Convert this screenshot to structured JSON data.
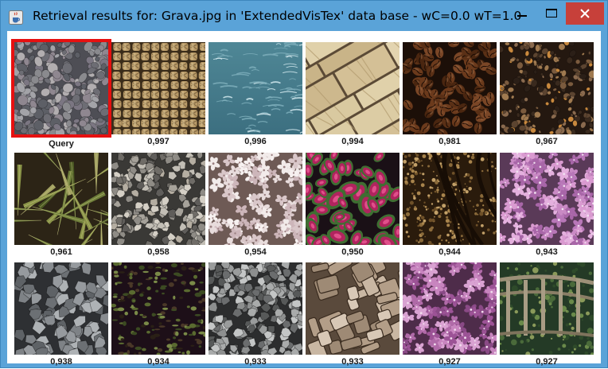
{
  "window": {
    "title": "Retrieval results for: Grava.jpg in 'ExtendedVisTex' data base - wC=0.0 wT=1.0",
    "app_icon": "java-cup-icon",
    "controls": {
      "minimize_icon": "minimize-icon",
      "maximize_icon": "maximize-icon",
      "close_icon": "close-icon"
    },
    "accent_color": "#5aa3d8",
    "close_color": "#c7403a",
    "query_highlight_color": "#e61010"
  },
  "results": [
    {
      "label": "Query",
      "texture": "gravel",
      "is_query": true
    },
    {
      "label": "0,997",
      "texture": "woven-rope"
    },
    {
      "label": "0,996",
      "texture": "water"
    },
    {
      "label": "0,994",
      "texture": "stone-tiles"
    },
    {
      "label": "0,981",
      "texture": "coffee-beans"
    },
    {
      "label": "0,967",
      "texture": "soil-pebbles"
    },
    {
      "label": "0,961",
      "texture": "agave-leaves"
    },
    {
      "label": "0,958",
      "texture": "gravel-light"
    },
    {
      "label": "0,954",
      "texture": "white-flowers"
    },
    {
      "label": "0,950",
      "texture": "coleus-leaves"
    },
    {
      "label": "0,944",
      "texture": "bark-brown"
    },
    {
      "label": "0,943",
      "texture": "pink-flowers"
    },
    {
      "label": "0,938",
      "texture": "gray-stones"
    },
    {
      "label": "0,934",
      "texture": "dark-foliage"
    },
    {
      "label": "0,933",
      "texture": "crushed-stone"
    },
    {
      "label": "0,933",
      "texture": "tree-bark"
    },
    {
      "label": "0,927",
      "texture": "purple-flowers"
    },
    {
      "label": "0,927",
      "texture": "wooden-fence"
    }
  ]
}
